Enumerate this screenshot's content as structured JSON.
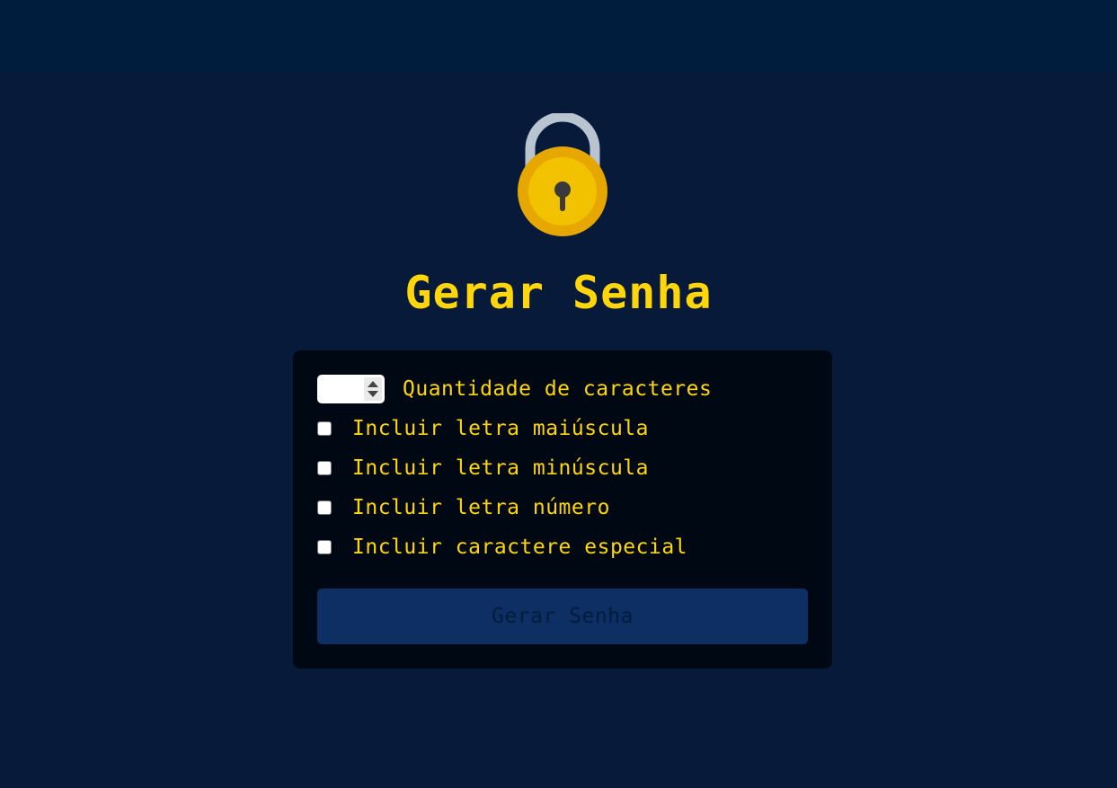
{
  "header": {
    "title": "Gerar Senha",
    "logo_icon": "padlock-icon"
  },
  "form": {
    "length_input": {
      "value": "",
      "label": "Quantidade de caracteres"
    },
    "options": [
      {
        "label": "Incluir letra maiúscula",
        "checked": false
      },
      {
        "label": "Incluir letra minúscula",
        "checked": false
      },
      {
        "label": "Incluir letra número",
        "checked": false
      },
      {
        "label": "Incluir caractere especial",
        "checked": false
      }
    ],
    "submit_label": "Gerar Senha"
  },
  "colors": {
    "background": "#071a3a",
    "topbar": "#001d3d",
    "card": "#000814",
    "accent": "#ffd60a",
    "button": "#0e2f63"
  }
}
